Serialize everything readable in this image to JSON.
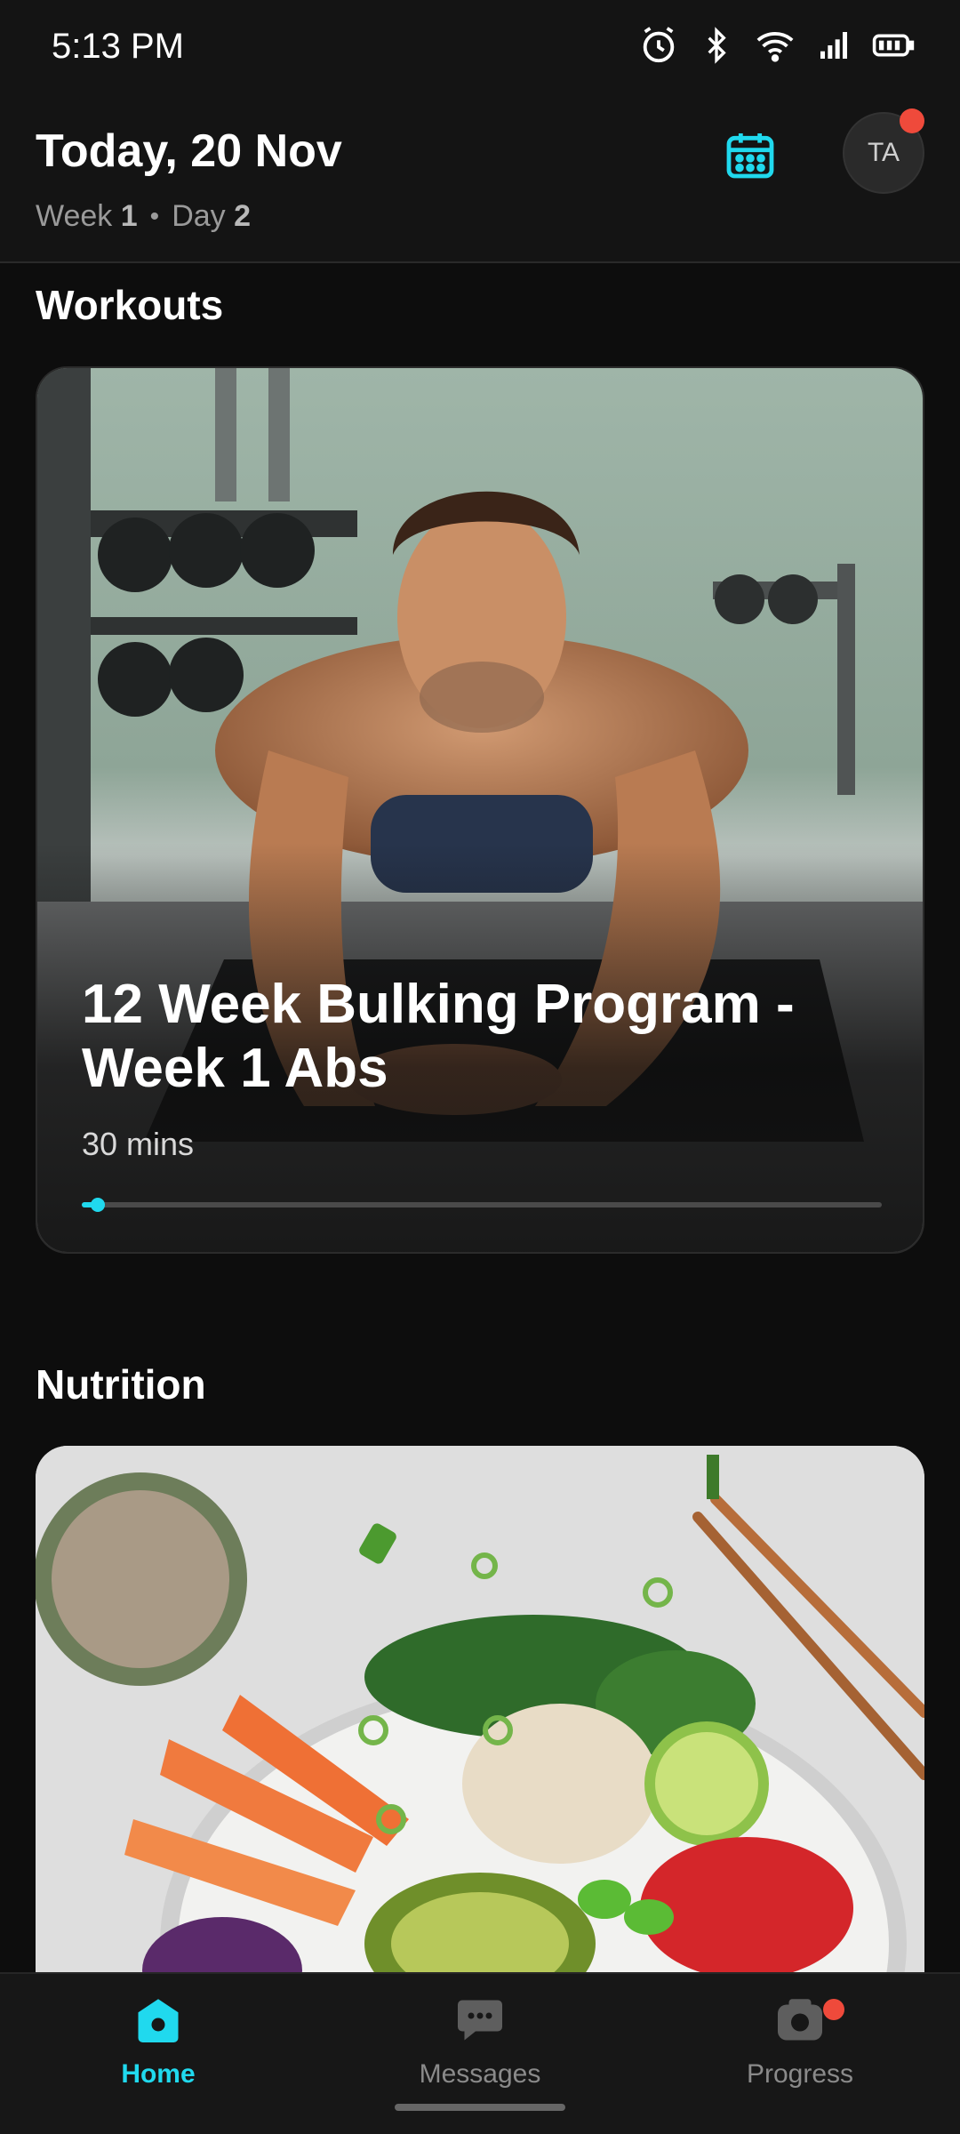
{
  "status_bar": {
    "time": "5:13 PM",
    "icons": [
      "alarm-icon",
      "bluetooth-icon",
      "wifi-icon",
      "signal-icon",
      "battery-icon"
    ]
  },
  "header": {
    "title": "Today, 20 Nov",
    "week_label": "Week",
    "week_value": "1",
    "separator": "•",
    "day_label": "Day",
    "day_value": "2",
    "calendar_icon": "calendar-icon",
    "avatar_initials": "TA",
    "avatar_has_notification": true
  },
  "workouts": {
    "section_title": "Workouts",
    "card": {
      "title": "12 Week Bulking Program - Week 1 Abs",
      "duration": "30 mins",
      "progress_percent": 2
    }
  },
  "nutrition": {
    "section_title": "Nutrition"
  },
  "bottom_nav": {
    "items": [
      {
        "label": "Home",
        "icon": "home-icon",
        "active": true,
        "badge": false
      },
      {
        "label": "Messages",
        "icon": "chat-icon",
        "active": false,
        "badge": false
      },
      {
        "label": "Progress",
        "icon": "camera-icon",
        "active": false,
        "badge": true
      }
    ]
  },
  "colors": {
    "accent": "#20d9ee",
    "badge": "#ef4a3b",
    "background": "#0d0d0d"
  }
}
